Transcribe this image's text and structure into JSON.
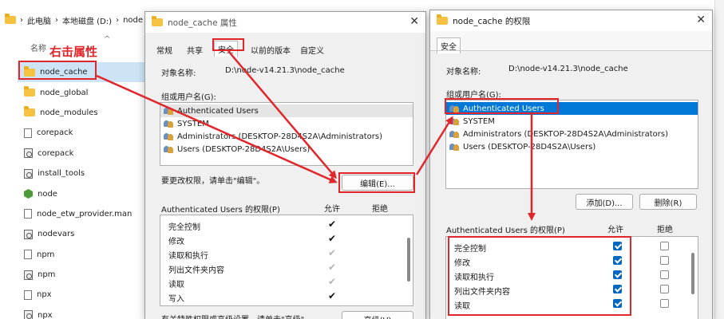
{
  "explorer": {
    "breadcrumb": [
      "此电脑",
      "本地磁盘 (D:)",
      "node"
    ],
    "name_header": "名称",
    "files": [
      {
        "name": "node_cache",
        "icon": "folder-icon",
        "selected": true
      },
      {
        "name": "node_global",
        "icon": "folder-icon"
      },
      {
        "name": "node_modules",
        "icon": "folder-icon"
      },
      {
        "name": "corepack",
        "icon": "file-icon"
      },
      {
        "name": "corepack",
        "icon": "cmd-file-icon"
      },
      {
        "name": "install_tools",
        "icon": "cmd-file-icon"
      },
      {
        "name": "node",
        "icon": "node-icon"
      },
      {
        "name": "node_etw_provider.man",
        "icon": "file-icon"
      },
      {
        "name": "nodevars",
        "icon": "cmd-file-icon"
      },
      {
        "name": "npm",
        "icon": "file-icon"
      },
      {
        "name": "npm",
        "icon": "cmd-file-icon"
      },
      {
        "name": "npx",
        "icon": "file-icon"
      },
      {
        "name": "npx",
        "icon": "cmd-file-icon"
      }
    ]
  },
  "annotation": {
    "label": "右击属性",
    "color": "#e0262b"
  },
  "props_dialog": {
    "title": "node_cache 属性",
    "tabs": [
      "常规",
      "共享",
      "安全",
      "以前的版本",
      "自定义"
    ],
    "active_tab": "安全",
    "object_label": "对象名称:",
    "object_value": "D:\\node-v14.21.3\\node_cache",
    "group_label": "组或用户名(G):",
    "users": [
      "Authenticated Users",
      "SYSTEM",
      "Administrators (DESKTOP-28D4S2A\\Administrators)",
      "Users (DESKTOP-28D4S2A\\Users)"
    ],
    "change_hint": "要更改权限，请单击\"编辑\"。",
    "edit_button": "编辑(E)...",
    "perm_title": "Authenticated Users 的权限(P)",
    "allow_header": "允许",
    "deny_header": "拒绝",
    "permissions": [
      {
        "name": "完全控制",
        "allow": "dark"
      },
      {
        "name": "修改",
        "allow": "dark"
      },
      {
        "name": "读取和执行",
        "allow": "gray"
      },
      {
        "name": "列出文件夹内容",
        "allow": "gray"
      },
      {
        "name": "读取",
        "allow": "gray"
      },
      {
        "name": "写入",
        "allow": "dark"
      }
    ],
    "bottom_hint": "有关特殊权限或高级设置，请单击\"高级\"。",
    "advanced_button": "高级(V)"
  },
  "perm_dialog": {
    "title": "node_cache 的权限",
    "tab": "安全",
    "object_label": "对象名称:",
    "object_value": "D:\\node-v14.21.3\\node_cache",
    "group_label": "组或用户名(G):",
    "users": [
      "Authenticated Users",
      "SYSTEM",
      "Administrators (DESKTOP-28D4S2A\\Administrators)",
      "Users (DESKTOP-28D4S2A\\Users)"
    ],
    "add_button": "添加(D)...",
    "remove_button": "删除(R)",
    "perm_title": "Authenticated Users 的权限(P)",
    "allow_header": "允许",
    "deny_header": "拒绝",
    "permissions": [
      {
        "name": "完全控制",
        "allow": true,
        "deny": false
      },
      {
        "name": "修改",
        "allow": true,
        "deny": false
      },
      {
        "name": "读取和执行",
        "allow": true,
        "deny": false
      },
      {
        "name": "列出文件夹内容",
        "allow": true,
        "deny": false
      },
      {
        "name": "读取",
        "allow": true,
        "deny": false
      }
    ]
  }
}
